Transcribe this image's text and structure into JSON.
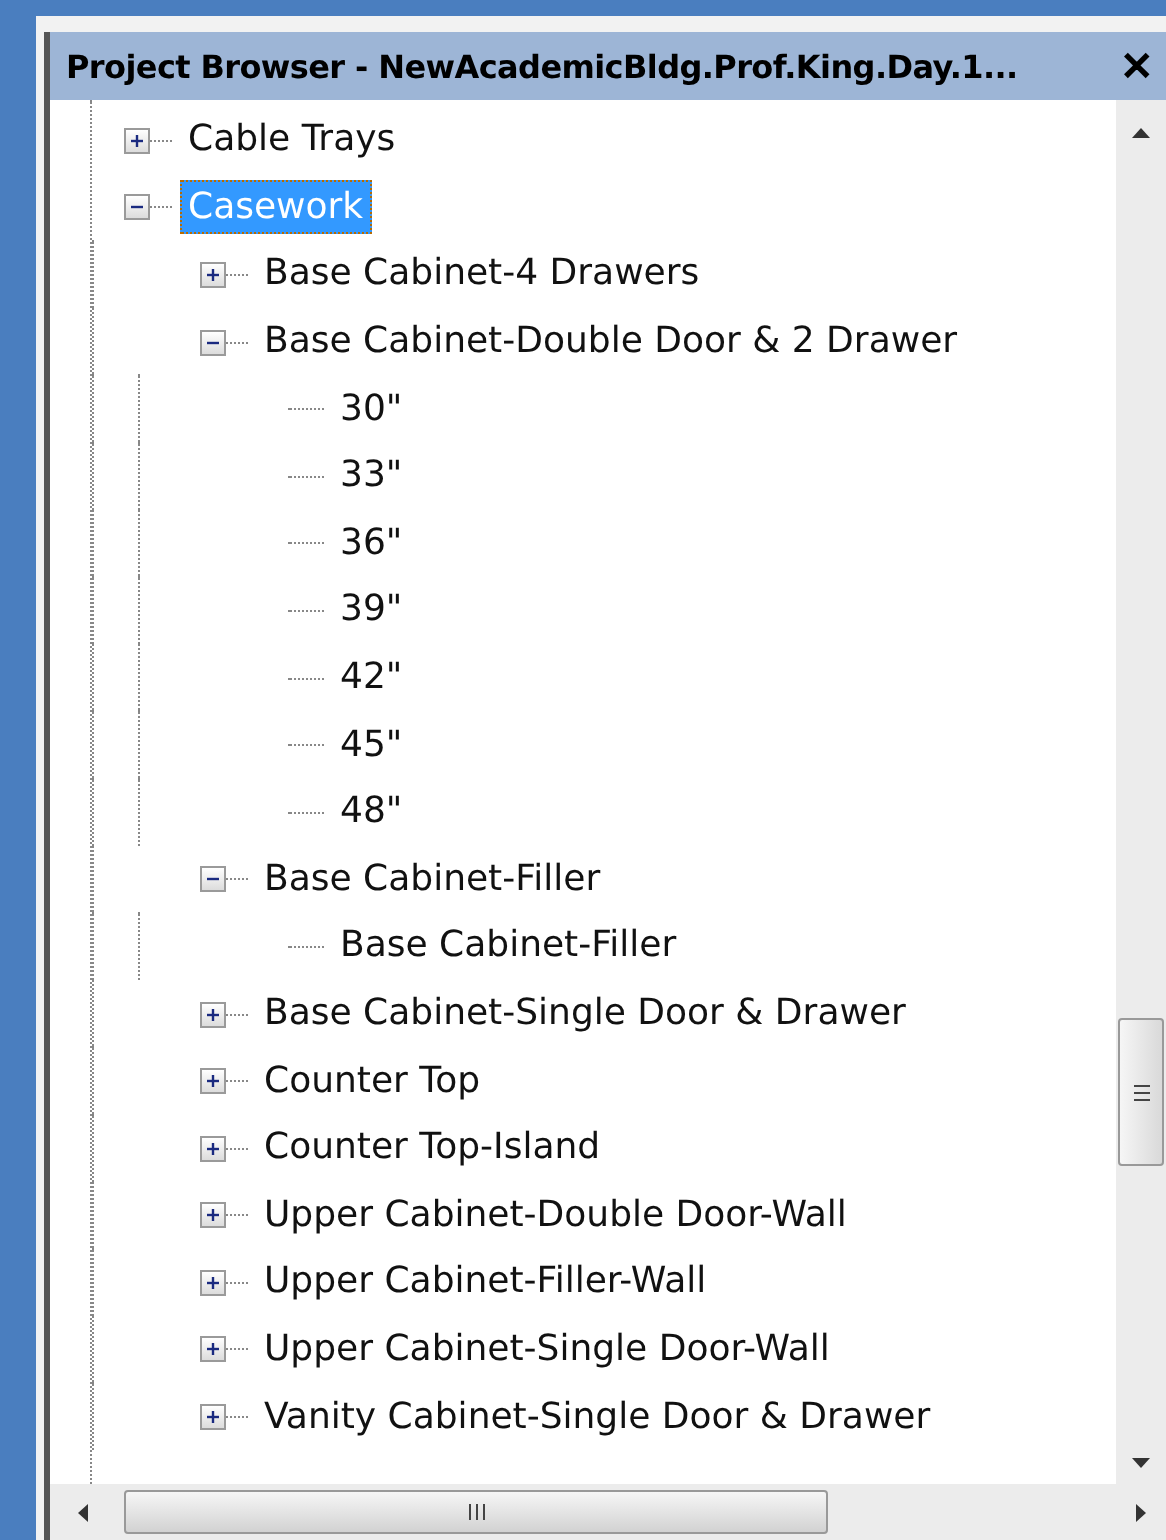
{
  "window": {
    "title": "Project Browser - NewAcademicBldg.Prof.King.Day.1...",
    "close": "✕"
  },
  "tree": [
    {
      "label": "Cable Trays",
      "selected": false,
      "expanded": false
    },
    {
      "label": "Casework",
      "selected": true,
      "expanded": true,
      "children": [
        {
          "label": "Base Cabinet-4 Drawers",
          "selected": false,
          "expanded": false
        },
        {
          "label": "Base Cabinet-Double Door & 2 Drawer",
          "selected": false,
          "expanded": true,
          "children": [
            {
              "label": "30\"",
              "selected": false
            },
            {
              "label": "33\"",
              "selected": false
            },
            {
              "label": "36\"",
              "selected": false
            },
            {
              "label": "39\"",
              "selected": false
            },
            {
              "label": "42\"",
              "selected": false
            },
            {
              "label": "45\"",
              "selected": false
            },
            {
              "label": "48\"",
              "selected": false
            }
          ]
        },
        {
          "label": "Base Cabinet-Filler",
          "selected": false,
          "expanded": true,
          "children": [
            {
              "label": "Base Cabinet-Filler",
              "selected": false
            }
          ]
        },
        {
          "label": "Base Cabinet-Single Door & Drawer",
          "selected": false,
          "expanded": false
        },
        {
          "label": "Counter Top",
          "selected": false,
          "expanded": false
        },
        {
          "label": "Counter Top-Island",
          "selected": false,
          "expanded": false
        },
        {
          "label": "Upper Cabinet-Double Door-Wall",
          "selected": false,
          "expanded": false
        },
        {
          "label": "Upper Cabinet-Filler-Wall",
          "selected": false,
          "expanded": false
        },
        {
          "label": "Upper Cabinet-Single Door-Wall",
          "selected": false,
          "expanded": false
        },
        {
          "label": "Vanity Cabinet-Single Door & Drawer",
          "selected": false,
          "expanded": false
        }
      ]
    }
  ]
}
